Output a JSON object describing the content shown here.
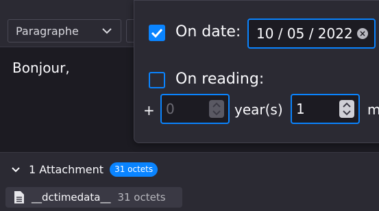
{
  "toolbar": {
    "paragraph_format": "Paragraphe",
    "chevron_icon": "chevron-down-icon"
  },
  "editor": {
    "body_text": "Bonjour,"
  },
  "reminder_popup": {
    "on_date": {
      "checked": true,
      "label": "On date:",
      "value": "10 / 05 / 2022",
      "clear_icon": "clear-icon"
    },
    "on_reading": {
      "checked": false,
      "label": "On reading:",
      "plus_sign": "+",
      "years_value": "0",
      "years_label": "year(s)",
      "months_value": "1",
      "months_label_partial": "m"
    }
  },
  "attachments": {
    "toggle_icon": "chevron-down-icon",
    "summary": "1 Attachment",
    "total_size": "31 octets",
    "items": [
      {
        "icon": "file-icon",
        "name": "__dctimedata__",
        "size": "31 octets"
      }
    ]
  },
  "colors": {
    "accent": "#0a84ff",
    "background": "#1c1b22",
    "panel": "#2b2a33"
  }
}
